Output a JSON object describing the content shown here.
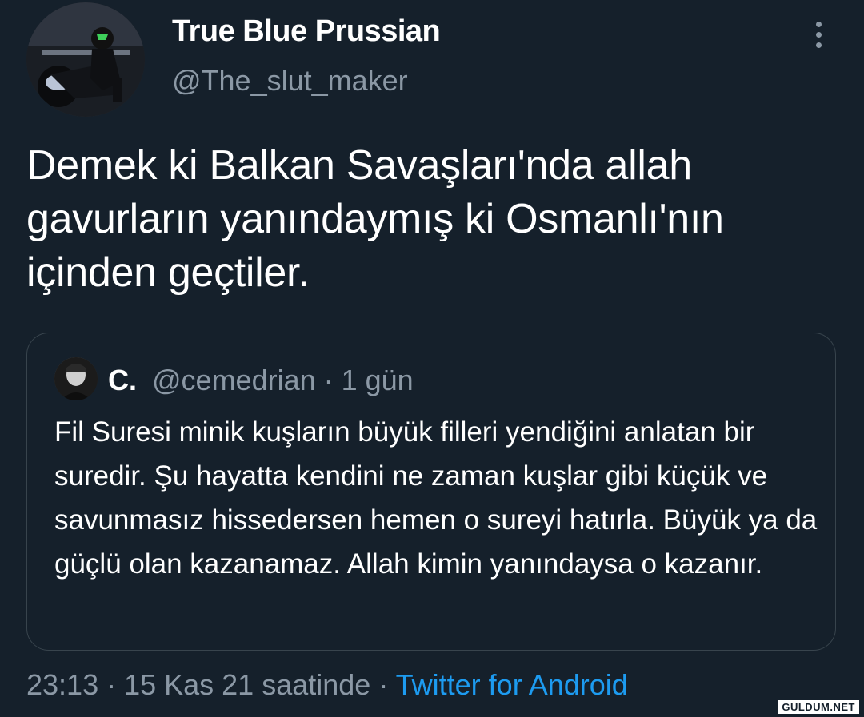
{
  "author": {
    "display_name": "True Blue Prussian",
    "handle": "@The_slut_maker"
  },
  "tweet": {
    "text": "Demek ki Balkan Savaşları'nda allah gavurların yanındaymış ki Osmanlı'nın içinden geçtiler."
  },
  "quoted_tweet": {
    "display_name": "C.",
    "handle_time": "@cemedrian · 1 gün",
    "text": "Fil Suresi minik kuşların büyük filleri yendiğini anlatan bir suredir. Şu hayatta kendini ne zaman kuşlar gibi küçük ve savunmasız hissedersen hemen o sureyi hatırla. Büyük ya da güçlü olan kazanamaz. Allah kimin yanındaysa o kazanır."
  },
  "footer": {
    "timestamp": "23:13 · 15 Kas 21 saatinde · ",
    "source": "Twitter for Android"
  },
  "watermark": "GULDUM.NET",
  "colors": {
    "background": "#15202b",
    "secondary_text": "#8b98a5",
    "link": "#1d9bf0",
    "border": "#38444d"
  },
  "icons": {
    "more": "more-vertical-icon"
  }
}
